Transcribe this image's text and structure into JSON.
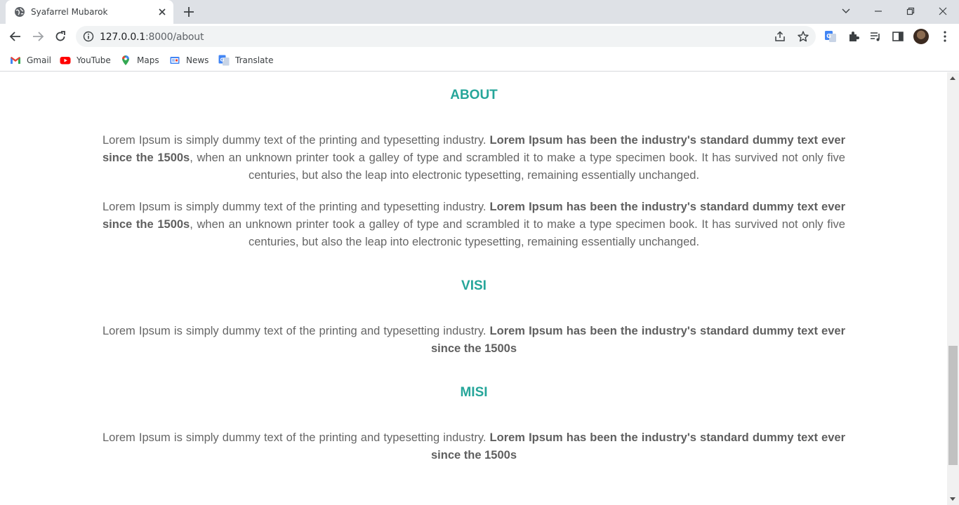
{
  "browser": {
    "tab_title": "Syafarrel Mubarok",
    "url_host": "127.0.0.1",
    "url_path": ":8000/about",
    "bookmarks": [
      {
        "label": "Gmail",
        "icon": "gmail-icon"
      },
      {
        "label": "YouTube",
        "icon": "youtube-icon"
      },
      {
        "label": "Maps",
        "icon": "maps-icon"
      },
      {
        "label": "News",
        "icon": "news-icon"
      },
      {
        "label": "Translate",
        "icon": "translate-icon"
      }
    ]
  },
  "page": {
    "about": {
      "title": "ABOUT",
      "paragraphs": [
        {
          "lead": "Lorem Ipsum is simply dummy text of the printing and typesetting industry. ",
          "bold": "Lorem Ipsum has been the industry's standard dummy text ever since the 1500s",
          "tail": ", when an unknown printer took a galley of type and scrambled it to make a type specimen book. It has survived not only five centuries, but also the leap into electronic typesetting, remaining essentially unchanged."
        },
        {
          "lead": "Lorem Ipsum is simply dummy text of the printing and typesetting industry. ",
          "bold": "Lorem Ipsum has been the industry's standard dummy text ever since the 1500s",
          "tail": ", when an unknown printer took a galley of type and scrambled it to make a type specimen book. It has survived not only five centuries, but also the leap into electronic typesetting, remaining essentially unchanged."
        }
      ]
    },
    "visi": {
      "title": "VISI",
      "lead": "Lorem Ipsum is simply dummy text of the printing and typesetting industry. ",
      "bold": "Lorem Ipsum has been the industry's standard dummy text ever since the 1500s"
    },
    "misi": {
      "title": "MISI",
      "lead": "Lorem Ipsum is simply dummy text of the printing and typesetting industry. ",
      "bold": "Lorem Ipsum has been the industry's standard dummy text ever since the 1500s"
    }
  },
  "colors": {
    "heading": "#26a69a",
    "body_text": "#666666",
    "tabstrip": "#dee1e6"
  }
}
